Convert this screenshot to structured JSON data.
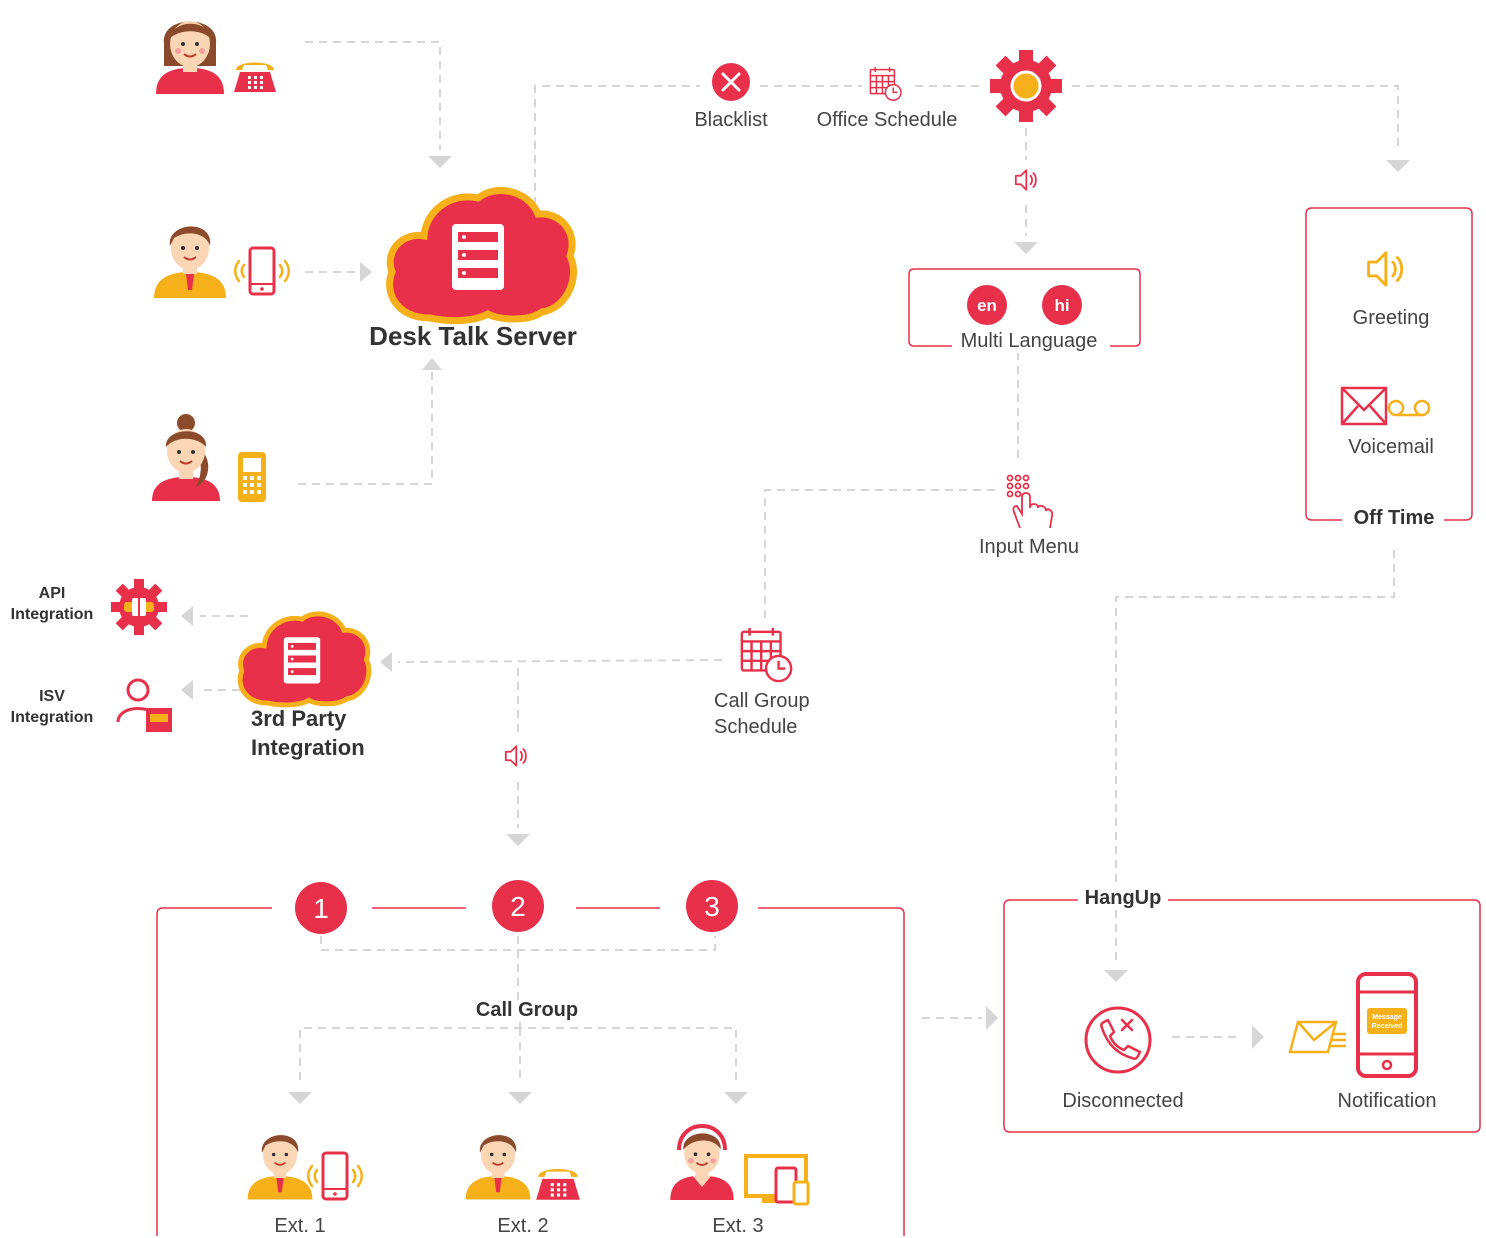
{
  "colors": {
    "red": "#e8304a",
    "yellow": "#f6b01a",
    "dash": "#d8d8d8",
    "skin": "#fbd6b5",
    "hair": "#8b4a2b"
  },
  "server": {
    "title": "Desk Talk Server"
  },
  "top_flow": {
    "blacklist": "Blacklist",
    "office_schedule": "Office Schedule"
  },
  "multi_language": {
    "title": "Multi Language",
    "languages": [
      "en",
      "hi"
    ]
  },
  "input_menu": {
    "label": "Input Menu"
  },
  "off_time": {
    "title": "Off Time",
    "greeting": "Greeting",
    "voicemail": "Voicemail"
  },
  "call_group_schedule": {
    "line1": "Call Group",
    "line2": "Schedule"
  },
  "integration": {
    "title_line1": "3rd Party",
    "title_line2": "Integration",
    "api_line1": "API",
    "api_line2": "Integration",
    "isv_line1": "ISV",
    "isv_line2": "Integration"
  },
  "call_group": {
    "title": "Call Group",
    "steps": [
      "1",
      "2",
      "3"
    ],
    "extensions": [
      "Ext. 1",
      "Ext. 2",
      "Ext. 3"
    ]
  },
  "hangup": {
    "title": "HangUp",
    "disconnected": "Disconnected",
    "notification": "Notification",
    "message_line1": "Message",
    "message_line2": "Received"
  },
  "icons": [
    "caller-woman-icon",
    "desk-phone-icon",
    "caller-man-icon",
    "mobile-phone-icon",
    "caller-woman-ponytail-icon",
    "feature-phone-icon",
    "cloud-server-icon",
    "blacklist-x-icon",
    "calendar-clock-icon",
    "gear-icon",
    "speaker-icon",
    "keypad-touch-icon",
    "voicemail-icon",
    "api-plug-gear-icon",
    "isv-user-icon",
    "call-disconnected-icon",
    "envelope-icon",
    "smartphone-notification-icon",
    "headset-agent-icon",
    "computer-devices-icon"
  ]
}
